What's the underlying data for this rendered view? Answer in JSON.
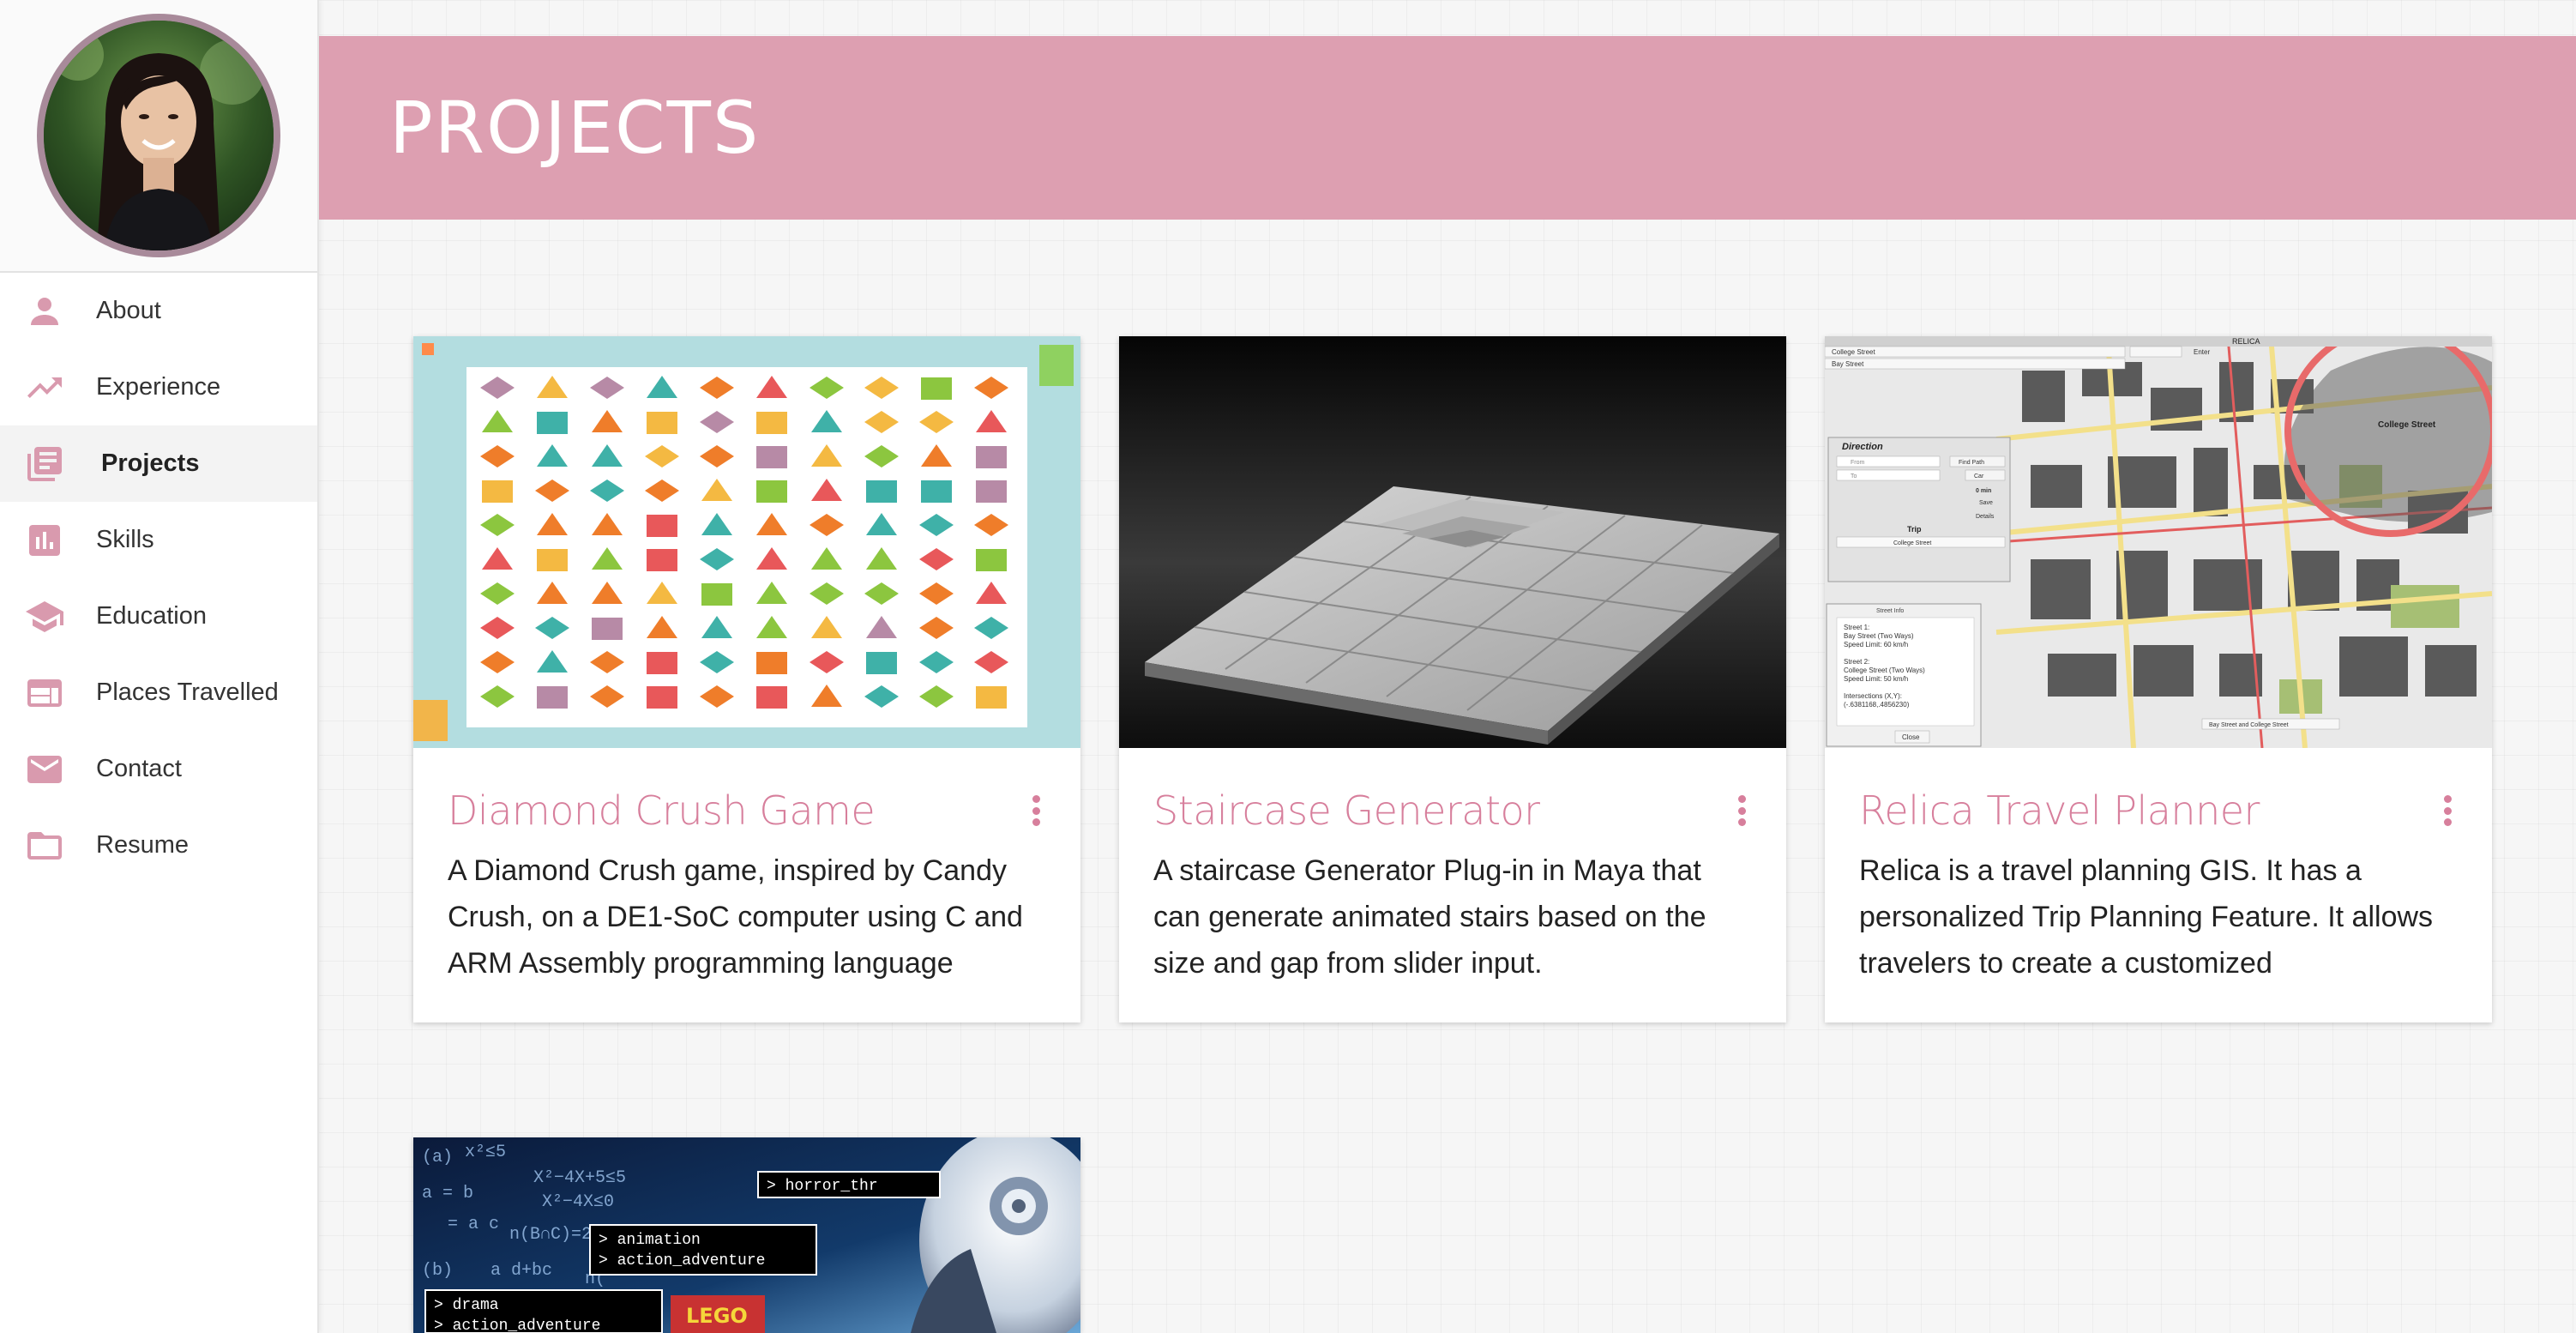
{
  "sidebar": {
    "items": [
      {
        "label": "About",
        "icon": "person-icon"
      },
      {
        "label": "Experience",
        "icon": "trending-up-icon"
      },
      {
        "label": "Projects",
        "icon": "library-books-icon"
      },
      {
        "label": "Skills",
        "icon": "bar-chart-icon"
      },
      {
        "label": "Education",
        "icon": "school-icon"
      },
      {
        "label": "Places Travelled",
        "icon": "web-layout-icon"
      },
      {
        "label": "Contact",
        "icon": "mail-icon"
      },
      {
        "label": "Resume",
        "icon": "folder-icon"
      }
    ],
    "active": "Projects"
  },
  "header": {
    "title": "PROJECTS"
  },
  "projects": [
    {
      "title": "Diamond Crush Game",
      "description": "A Diamond Crush game, inspired by Candy Crush, on a DE1-SoC computer using C and ARM Assembly programming language"
    },
    {
      "title": "Staircase Generator",
      "description": "A staircase Generator Plug-in in Maya that can generate animated stairs based on the size and gap from slider input."
    },
    {
      "title": "Relica Travel Planner",
      "description": "Relica is a travel planning GIS. It has a personalized Trip Planning Feature. It allows travelers to create a customized"
    }
  ],
  "map_labels": {
    "app_name": "RELICA",
    "search_1": "College Street",
    "search_2": "Bay Street",
    "enter": "Enter",
    "panel_title": "Direction",
    "from": "From",
    "to": "To",
    "find_path": "Find Path",
    "car": "Car",
    "time": "0 min",
    "save": "Save",
    "details": "Details",
    "trip": "Trip",
    "trip_value": "College Street",
    "street_info": "Street Info",
    "street_1": "Street 1:",
    "street_1_val": "Bay Street (Two Ways)",
    "speed_1": "Speed Limit: 60 km/h",
    "street_2": "Street 2:",
    "street_2_val": "College Street (Two Ways)",
    "speed_2": "Speed Limit: 50 km/h",
    "intersections": "Intersections (X,Y):",
    "coords": "(-.6381168,.4856230)",
    "close": "Close",
    "bottom": "Bay Street and College Street",
    "callout": "College Street"
  },
  "ml_labels": {
    "line_1": "> horror_thr",
    "line_2": "> animation",
    "line_3": "> action_adventure",
    "line_4": "> drama",
    "line_5": "> action_adventure",
    "brick": "LEGO"
  },
  "colors": {
    "accent": "#dd9fb1",
    "card_title": "#d77f9c",
    "icon": "#d99aae"
  }
}
